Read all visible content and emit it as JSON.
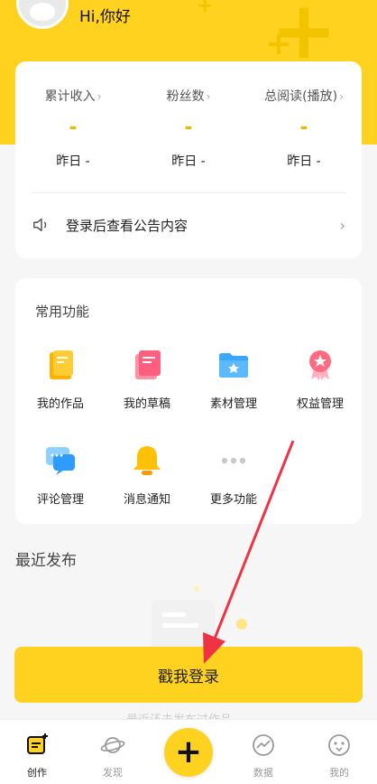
{
  "header": {
    "greeting": "Hi,你好"
  },
  "stats": [
    {
      "title": "累计收入",
      "value": "-",
      "sub": "昨日 -"
    },
    {
      "title": "粉丝数",
      "value": "-",
      "sub": "昨日 -"
    },
    {
      "title": "总阅读(播放)",
      "value": "-",
      "sub": "昨日 -"
    }
  ],
  "notice": {
    "text": "登录后查看公告内容"
  },
  "functions": {
    "title": "常用功能",
    "items": [
      {
        "label": "我的作品",
        "icon": "works-icon"
      },
      {
        "label": "我的草稿",
        "icon": "drafts-icon"
      },
      {
        "label": "素材管理",
        "icon": "folder-icon"
      },
      {
        "label": "权益管理",
        "icon": "badge-icon"
      },
      {
        "label": "评论管理",
        "icon": "comment-icon"
      },
      {
        "label": "消息通知",
        "icon": "bell-icon"
      },
      {
        "label": "更多功能",
        "icon": "more-icon"
      }
    ]
  },
  "recent": {
    "title": "最近发布",
    "empty_text": "最近还未发布过作品"
  },
  "login_button": "戳我登录",
  "tabbar": {
    "items": [
      {
        "label": "创作",
        "active": true
      },
      {
        "label": "发现"
      },
      {
        "label": ""
      },
      {
        "label": "数据"
      },
      {
        "label": "我的"
      }
    ],
    "fab": "+"
  },
  "colors": {
    "accent": "#ffd21f",
    "value": "#f1b800",
    "arrow": "#ee3344"
  }
}
